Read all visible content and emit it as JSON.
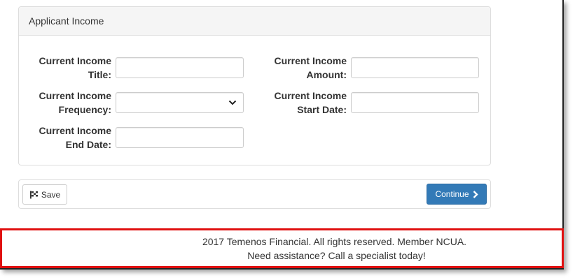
{
  "panel": {
    "title": "Applicant Income",
    "fields": [
      {
        "label_line1": "Current Income",
        "label_line2": "Title:",
        "value": ""
      },
      {
        "label_line1": "Current Income",
        "label_line2": "Amount:",
        "value": ""
      },
      {
        "label_line1": "Current Income",
        "label_line2": "Frequency:",
        "value": ""
      },
      {
        "label_line1": "Current Income",
        "label_line2": "Start Date:",
        "value": ""
      },
      {
        "label_line1": "Current Income",
        "label_line2": "End Date:",
        "value": ""
      }
    ]
  },
  "actions": {
    "save_label": "Save",
    "save_icon": "save-flag-icon",
    "continue_label": "Continue",
    "continue_icon": "chevron-right-icon",
    "continue_color": "#337ab7"
  },
  "footer": {
    "line1": "2017 Temenos Financial. All rights reserved. Member NCUA.",
    "line2": "Need assistance? Call a specialist today!",
    "highlight_color": "#e01010"
  }
}
